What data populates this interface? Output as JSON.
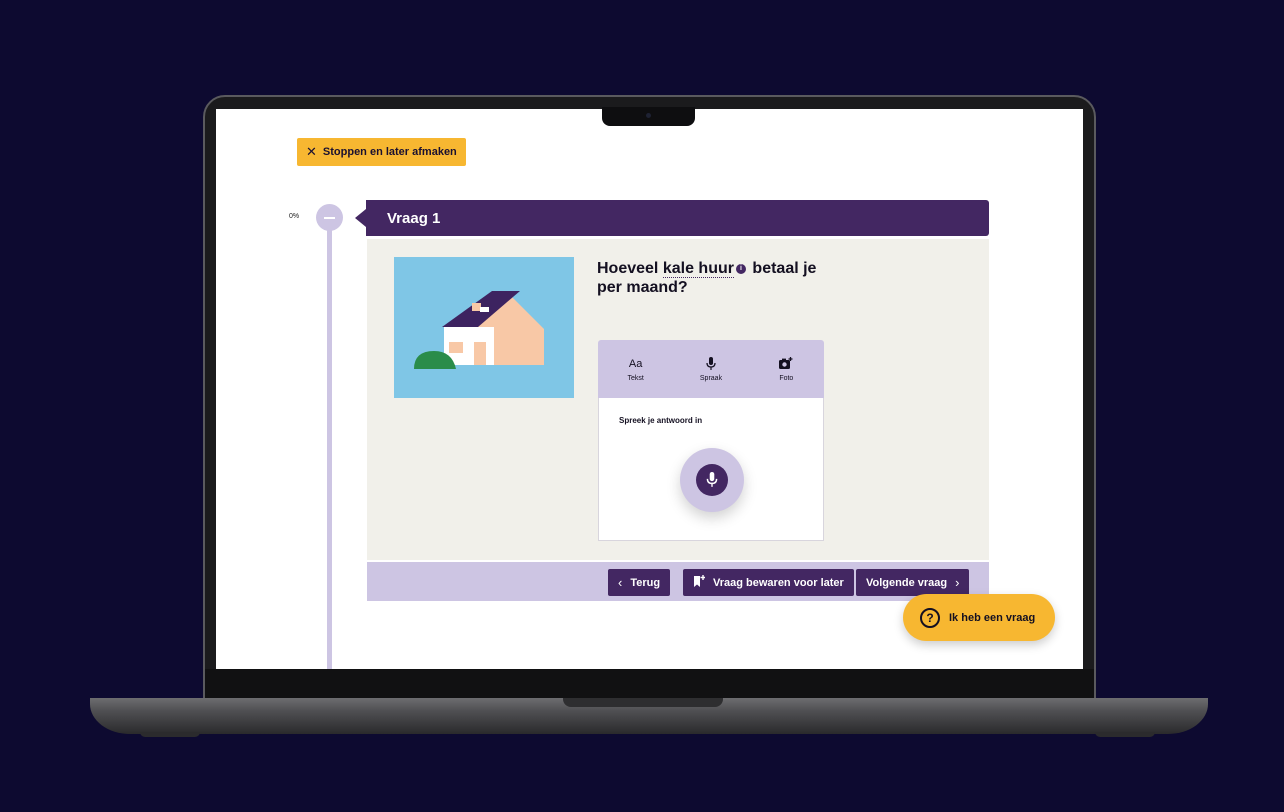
{
  "colors": {
    "background": "#0d0a30",
    "accent_yellow": "#f7b731",
    "brand_purple": "#432762",
    "light_purple": "#cdc5e3",
    "panel_bg": "#f1f0ea"
  },
  "top": {
    "stop_label": "Stoppen en later afmaken",
    "stop_icon": "close-icon"
  },
  "progress": {
    "label": "0%",
    "value": 0
  },
  "question": {
    "header": "Vraag 1",
    "text_before": "Hoeveel",
    "term": "kale huur",
    "info_icon": "i",
    "text_after": "betaal je per maand?"
  },
  "input_tabs": [
    {
      "icon": "Aa",
      "label": "Tekst"
    },
    {
      "icon": "microphone-icon",
      "label": "Spraak"
    },
    {
      "icon": "camera-plus-icon",
      "label": "Foto"
    }
  ],
  "answer": {
    "title": "Spreek je antwoord in",
    "record_icon": "microphone-icon"
  },
  "nav": {
    "back_label": "Terug",
    "save_label": "Vraag bewaren voor later",
    "next_label": "Volgende vraag"
  },
  "help": {
    "icon": "?",
    "label": "Ik heb een vraag"
  }
}
